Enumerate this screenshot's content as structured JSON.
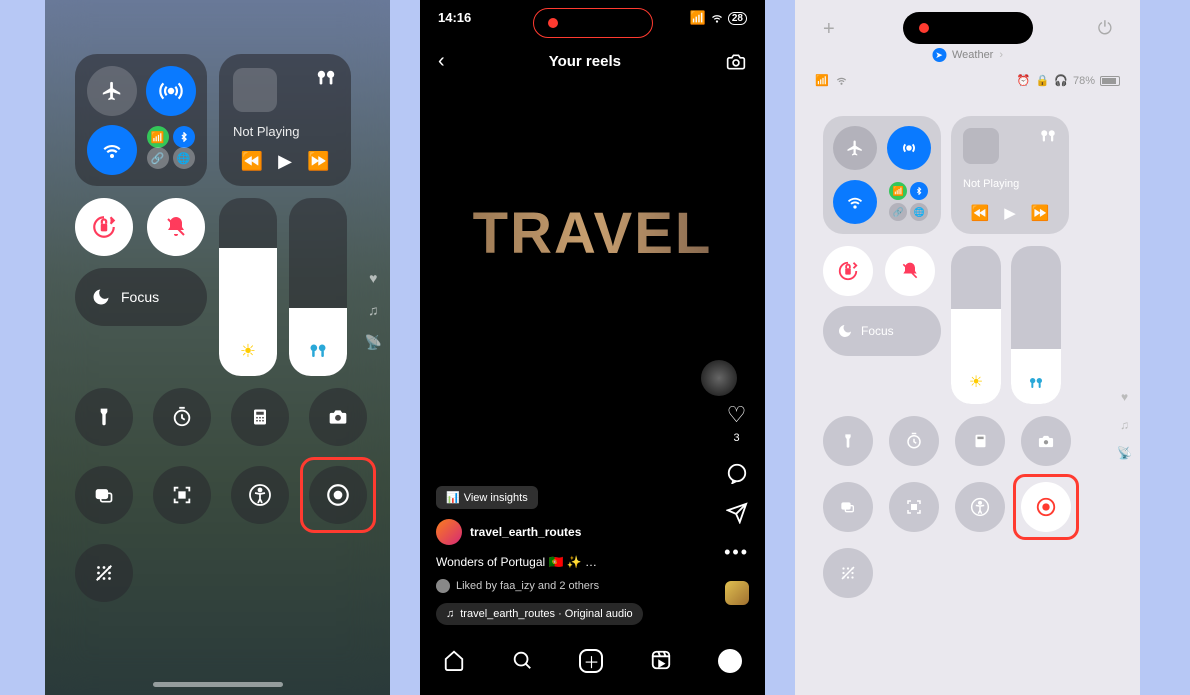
{
  "phone1": {
    "music": {
      "title": "Not Playing",
      "airpods": "🎧"
    },
    "focus_label": "Focus",
    "brightness_pct": 72,
    "volume_pct": 38
  },
  "phone2": {
    "time": "14:16",
    "battery": "28",
    "header": "Your reels",
    "hero_text": "TRAVEL",
    "insights": "View insights",
    "username": "travel_earth_routes",
    "caption": "Wonders of Portugal 🇵🇹 ✨ …",
    "liked_by": "Liked by faa_izy and 2 others",
    "audio": "travel_earth_routes · Original audio",
    "like_count": "3"
  },
  "phone3": {
    "weather_label": "Weather",
    "battery_text": "78%",
    "music": {
      "title": "Not Playing"
    },
    "focus_label": "Focus",
    "brightness_pct": 60,
    "volume_pct": 35
  }
}
